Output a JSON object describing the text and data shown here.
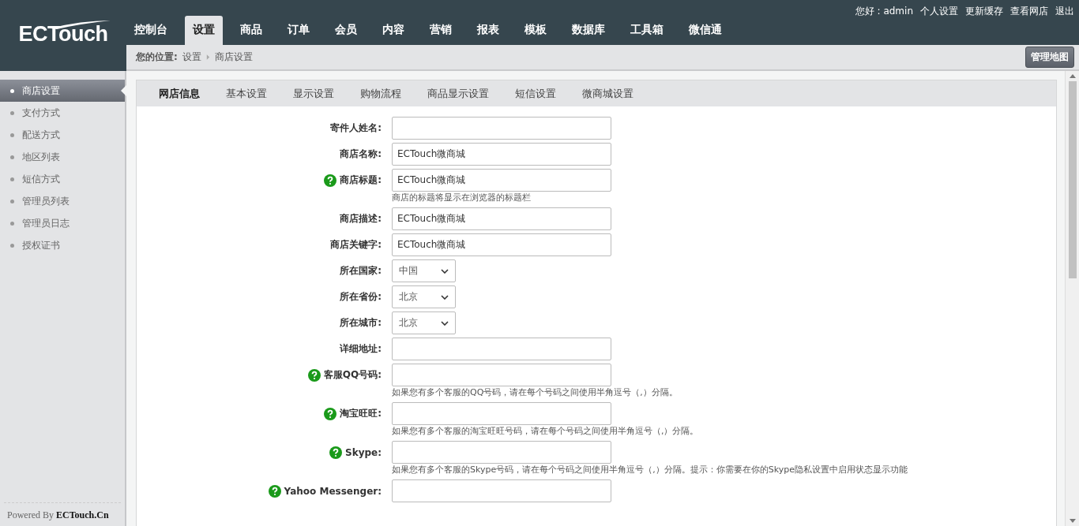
{
  "logo": {
    "text": "ECTouch"
  },
  "user_links": [
    "您好 : admin",
    "个人设置",
    "更新缓存",
    "查看网店",
    "退出"
  ],
  "nav": [
    {
      "label": "控制台",
      "selected": false
    },
    {
      "label": "设置",
      "selected": true
    },
    {
      "label": "商品",
      "selected": false
    },
    {
      "label": "订单",
      "selected": false
    },
    {
      "label": "会员",
      "selected": false
    },
    {
      "label": "内容",
      "selected": false
    },
    {
      "label": "营销",
      "selected": false
    },
    {
      "label": "报表",
      "selected": false
    },
    {
      "label": "模板",
      "selected": false
    },
    {
      "label": "数据库",
      "selected": false
    },
    {
      "label": "工具箱",
      "selected": false
    },
    {
      "label": "微信通",
      "selected": false
    }
  ],
  "breadcrumb": {
    "label": "您的位置:",
    "items": [
      "设置",
      "商店设置"
    ]
  },
  "map_button": "管理地图",
  "sidebar": {
    "items": [
      {
        "label": "商店设置",
        "selected": true
      },
      {
        "label": "支付方式",
        "selected": false
      },
      {
        "label": "配送方式",
        "selected": false
      },
      {
        "label": "地区列表",
        "selected": false
      },
      {
        "label": "短信方式",
        "selected": false
      },
      {
        "label": "管理员列表",
        "selected": false
      },
      {
        "label": "管理员日志",
        "selected": false
      },
      {
        "label": "授权证书",
        "selected": false
      }
    ],
    "footer": "Powered By **ECTouch.Cn**"
  },
  "tabs": [
    {
      "label": "网店信息",
      "selected": true
    },
    {
      "label": "基本设置",
      "selected": false
    },
    {
      "label": "显示设置",
      "selected": false
    },
    {
      "label": "购物流程",
      "selected": false
    },
    {
      "label": "商品显示设置",
      "selected": false
    },
    {
      "label": "短信设置",
      "selected": false
    },
    {
      "label": "微商城设置",
      "selected": false
    }
  ],
  "form": [
    {
      "kind": "text",
      "label": "寄件人姓名:",
      "help": false
    },
    {
      "kind": "text",
      "label": "商店名称:",
      "help": false,
      "value": "ECTouch微商城"
    },
    {
      "kind": "text",
      "label": "商店标题:",
      "help": true,
      "value": "ECTouch微商城",
      "hint": "商店的标题将显示在浏览器的标题栏"
    },
    {
      "kind": "text",
      "label": "商店描述:",
      "help": false,
      "value": "ECTouch微商城"
    },
    {
      "kind": "text",
      "label": "商店关键字:",
      "help": false,
      "value": "ECTouch微商城"
    },
    {
      "kind": "select",
      "label": "所在国家:",
      "help": false,
      "value": "中国"
    },
    {
      "kind": "select",
      "label": "所在省份:",
      "help": false,
      "value": "北京"
    },
    {
      "kind": "select",
      "label": "所在城市:",
      "help": false,
      "value": "北京"
    },
    {
      "kind": "text",
      "label": "详细地址:",
      "help": false
    },
    {
      "kind": "text",
      "label": "客服QQ号码:",
      "help": true,
      "hint": "如果您有多个客服的QQ号码，请在每个号码之间使用半角逗号（,）分隔。"
    },
    {
      "kind": "text",
      "label": "淘宝旺旺:",
      "help": true,
      "hint": "如果您有多个客服的淘宝旺旺号码，请在每个号码之间使用半角逗号（,）分隔。"
    },
    {
      "kind": "text",
      "label": "Skype:",
      "help": true,
      "hint": "如果您有多个客服的Skype号码，请在每个号码之间使用半角逗号（,）分隔。提示：你需要在你的Skype隐私设置中启用状态显示功能"
    },
    {
      "kind": "text",
      "label": "Yahoo Messenger:",
      "help": true
    }
  ]
}
